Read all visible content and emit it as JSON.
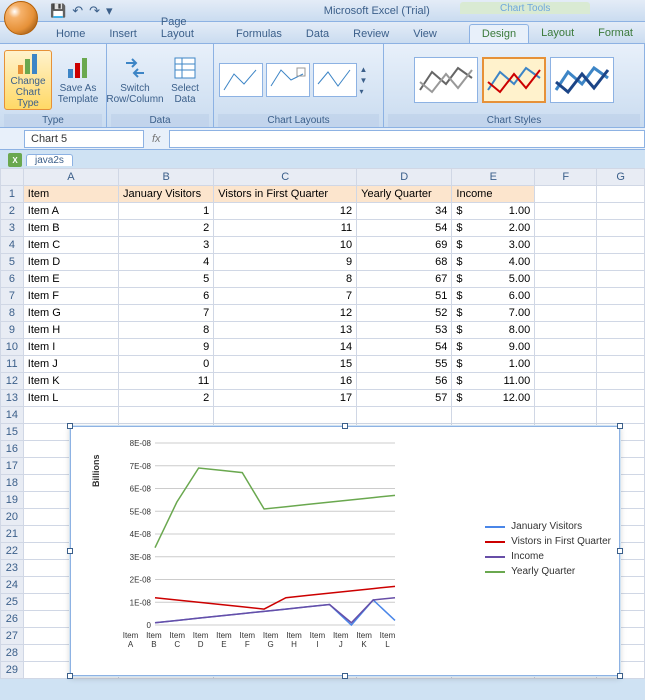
{
  "app": {
    "title": "Microsoft Excel (Trial)",
    "context_title": "Chart Tools"
  },
  "qat": {
    "save": "💾",
    "undo": "↶",
    "redo": "↷",
    "more": "▾"
  },
  "tabs": {
    "main": [
      "Home",
      "Insert",
      "Page Layout",
      "Formulas",
      "Data",
      "Review",
      "View"
    ],
    "ctx": [
      "Design",
      "Layout",
      "Format"
    ],
    "active": "Design"
  },
  "ribbon": {
    "type": {
      "label": "Type",
      "change": "Change Chart Type",
      "save": "Save As Template"
    },
    "data": {
      "label": "Data",
      "switch": "Switch Row/Column",
      "select": "Select Data"
    },
    "layouts": {
      "label": "Chart Layouts"
    },
    "styles": {
      "label": "Chart Styles"
    }
  },
  "formula_bar": {
    "name": "Chart 5",
    "fx": "fx",
    "formula": ""
  },
  "workbook": {
    "sheet": "java2s"
  },
  "columns": [
    "A",
    "B",
    "C",
    "D",
    "E",
    "F",
    "G"
  ],
  "headers": {
    "A": "Item",
    "B": "January Visitors",
    "C": "Vistors in First Quarter",
    "D": "Yearly Quarter",
    "E": "Income"
  },
  "rows": [
    {
      "n": 2,
      "item": "Item A",
      "jan": 1,
      "q1": 12,
      "yq": 34,
      "inc": "1.00"
    },
    {
      "n": 3,
      "item": "Item B",
      "jan": 2,
      "q1": 11,
      "yq": 54,
      "inc": "2.00"
    },
    {
      "n": 4,
      "item": "Item C",
      "jan": 3,
      "q1": 10,
      "yq": 69,
      "inc": "3.00"
    },
    {
      "n": 5,
      "item": "Item D",
      "jan": 4,
      "q1": 9,
      "yq": 68,
      "inc": "4.00"
    },
    {
      "n": 6,
      "item": "Item E",
      "jan": 5,
      "q1": 8,
      "yq": 67,
      "inc": "5.00"
    },
    {
      "n": 7,
      "item": "Item F",
      "jan": 6,
      "q1": 7,
      "yq": 51,
      "inc": "6.00"
    },
    {
      "n": 8,
      "item": "Item G",
      "jan": 7,
      "q1": 12,
      "yq": 52,
      "inc": "7.00"
    },
    {
      "n": 9,
      "item": "Item H",
      "jan": 8,
      "q1": 13,
      "yq": 53,
      "inc": "8.00"
    },
    {
      "n": 10,
      "item": "Item I",
      "jan": 9,
      "q1": 14,
      "yq": 54,
      "inc": "9.00"
    },
    {
      "n": 11,
      "item": "Item J",
      "jan": 0,
      "q1": 15,
      "yq": 55,
      "inc": "1.00"
    },
    {
      "n": 12,
      "item": "Item K",
      "jan": 11,
      "q1": 16,
      "yq": 56,
      "inc": "11.00"
    },
    {
      "n": 13,
      "item": "Item L",
      "jan": 2,
      "q1": 17,
      "yq": 57,
      "inc": "12.00"
    }
  ],
  "empty_rows": [
    14,
    15,
    16,
    17,
    18,
    19,
    20,
    21,
    22,
    23,
    24,
    25,
    26,
    27,
    28,
    29
  ],
  "chart_data": {
    "type": "line",
    "categories": [
      "Item A",
      "Item B",
      "Item C",
      "Item D",
      "Item E",
      "Item F",
      "Item G",
      "Item H",
      "Item I",
      "Item J",
      "Item K",
      "Item L"
    ],
    "series": [
      {
        "name": "January Visitors",
        "color": "#4a86e8",
        "values": [
          1,
          2,
          3,
          4,
          5,
          6,
          7,
          8,
          9,
          0,
          11,
          2
        ]
      },
      {
        "name": "Vistors in First Quarter",
        "color": "#cc0000",
        "values": [
          12,
          11,
          10,
          9,
          8,
          7,
          12,
          13,
          14,
          15,
          16,
          17
        ]
      },
      {
        "name": "Income",
        "color": "#674ea7",
        "values": [
          1,
          2,
          3,
          4,
          5,
          6,
          7,
          8,
          9,
          1,
          11,
          12
        ]
      },
      {
        "name": "Yearly Quarter",
        "color": "#6aa84f",
        "values": [
          34,
          54,
          69,
          68,
          67,
          51,
          52,
          53,
          54,
          55,
          56,
          57
        ]
      }
    ],
    "ylabel": "Billions",
    "yticks": [
      "0",
      "1E-08",
      "2E-08",
      "3E-08",
      "4E-08",
      "5E-08",
      "6E-08",
      "7E-08",
      "8E-08"
    ],
    "ylim": [
      0,
      80
    ]
  }
}
